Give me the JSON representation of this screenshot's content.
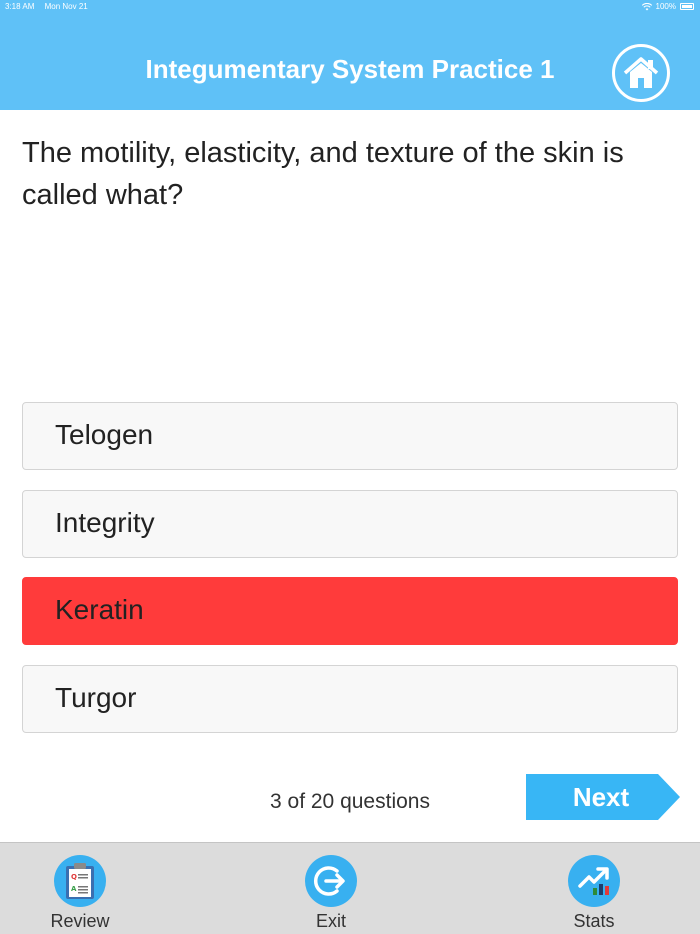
{
  "status_bar": {
    "time": "3:18 AM",
    "date": "Mon Nov 21",
    "battery": "100%"
  },
  "header": {
    "title": "Integumentary System Practice 1"
  },
  "question": {
    "text": "The motility, elasticity, and texture of the skin is called what?"
  },
  "answers": [
    {
      "label": "Telogen",
      "state": "default"
    },
    {
      "label": "Integrity",
      "state": "default"
    },
    {
      "label": "Keratin",
      "state": "incorrect",
      "color": "#ff3b3b"
    },
    {
      "label": "Turgor",
      "state": "default"
    }
  ],
  "progress": {
    "text": "3 of 20 questions",
    "current": 3,
    "total": 20
  },
  "next_button": {
    "label": "Next"
  },
  "tab_bar": {
    "items": [
      {
        "label": "Review",
        "icon": "clipboard-icon"
      },
      {
        "label": "Exit",
        "icon": "exit-icon"
      },
      {
        "label": "Stats",
        "icon": "chart-icon"
      }
    ]
  },
  "colors": {
    "accent": "#5fc1f7",
    "tab_icon": "#38b0f0",
    "incorrect": "#ff3b3b"
  }
}
